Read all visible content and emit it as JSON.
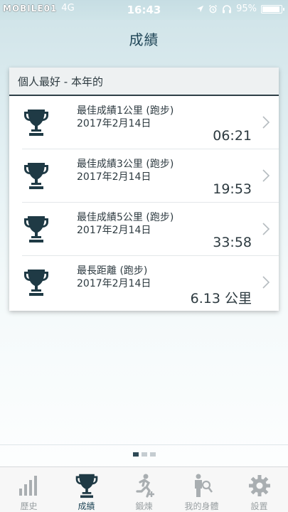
{
  "status_bar": {
    "watermark": "MOBILE01",
    "carrier": "4G",
    "time": "16:43",
    "battery_percent": "95%",
    "battery_level": 0.95
  },
  "nav": {
    "title": "成績"
  },
  "card": {
    "header": "個人最好 - 本年的",
    "records": [
      {
        "title": "最佳成績1公里 (跑步)",
        "date": "2017年2月14日",
        "value": "06:21"
      },
      {
        "title": "最佳成績3公里 (跑步)",
        "date": "2017年2月14日",
        "value": "19:53"
      },
      {
        "title": "最佳成績5公里 (跑步)",
        "date": "2017年2月14日",
        "value": "33:58"
      },
      {
        "title": "最長距離 (跑步)",
        "date": "2017年2月14日",
        "value": "6.13 公里"
      }
    ]
  },
  "page_indicator": {
    "count": 3,
    "active_index": 0
  },
  "tab_bar": {
    "items": [
      {
        "label": "歷史",
        "icon": "bar-chart-icon",
        "active": false
      },
      {
        "label": "成績",
        "icon": "trophy-icon",
        "active": true
      },
      {
        "label": "鍛煉",
        "icon": "runner-plus-icon",
        "active": false
      },
      {
        "label": "我的身體",
        "icon": "body-search-icon",
        "active": false
      },
      {
        "label": "設置",
        "icon": "gear-icon",
        "active": false
      }
    ]
  },
  "colors": {
    "accent": "#23495a",
    "icon_dark": "#1f3a45",
    "inactive": "#9aa0a3"
  }
}
